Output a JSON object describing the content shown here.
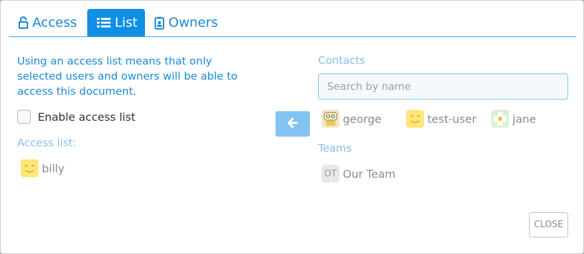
{
  "tabs": [
    {
      "label": "Access",
      "icon": "unlock-icon",
      "active": false
    },
    {
      "label": "List",
      "icon": "list-icon",
      "active": true
    },
    {
      "label": "Owners",
      "icon": "badge-icon",
      "active": false
    }
  ],
  "description": "Using an access list means that only selected users and owners will be able to access this document.",
  "enable_label": "Enable access list",
  "access_list": {
    "label": "Access list:",
    "users": [
      {
        "name": "billy",
        "avatar": "smiley"
      }
    ]
  },
  "contacts": {
    "label": "Contacts",
    "search_placeholder": "Search by name",
    "users": [
      {
        "name": "george",
        "avatar": "robot"
      },
      {
        "name": "test-user",
        "avatar": "smiley"
      },
      {
        "name": "jane",
        "avatar": "flower"
      }
    ]
  },
  "teams": {
    "label": "Teams",
    "items": [
      {
        "name": "Our Team",
        "initials": "OT"
      }
    ]
  },
  "close_label": "CLOSE",
  "colors": {
    "accent": "#0f8fe6",
    "accent_light": "#82c3f2",
    "label": "#82bfe9"
  }
}
